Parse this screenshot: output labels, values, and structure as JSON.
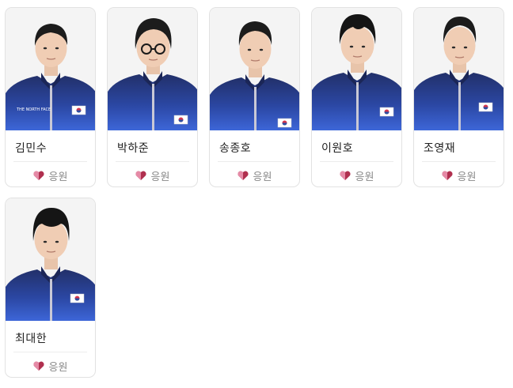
{
  "cheer_label": "응원",
  "colors": {
    "heart_dark": "#b0304f",
    "heart_light": "#e58aa6",
    "jacket_navy": "#22306a",
    "jacket_blue": "#3d66d8",
    "photo_bg": "#f4f4f4"
  },
  "athletes": [
    {
      "name": "김민수",
      "eyewear": false
    },
    {
      "name": "박하준",
      "eyewear": true
    },
    {
      "name": "송종호",
      "eyewear": false
    },
    {
      "name": "이원호",
      "eyewear": false
    },
    {
      "name": "조영재",
      "eyewear": false
    },
    {
      "name": "최대한",
      "eyewear": false
    }
  ]
}
